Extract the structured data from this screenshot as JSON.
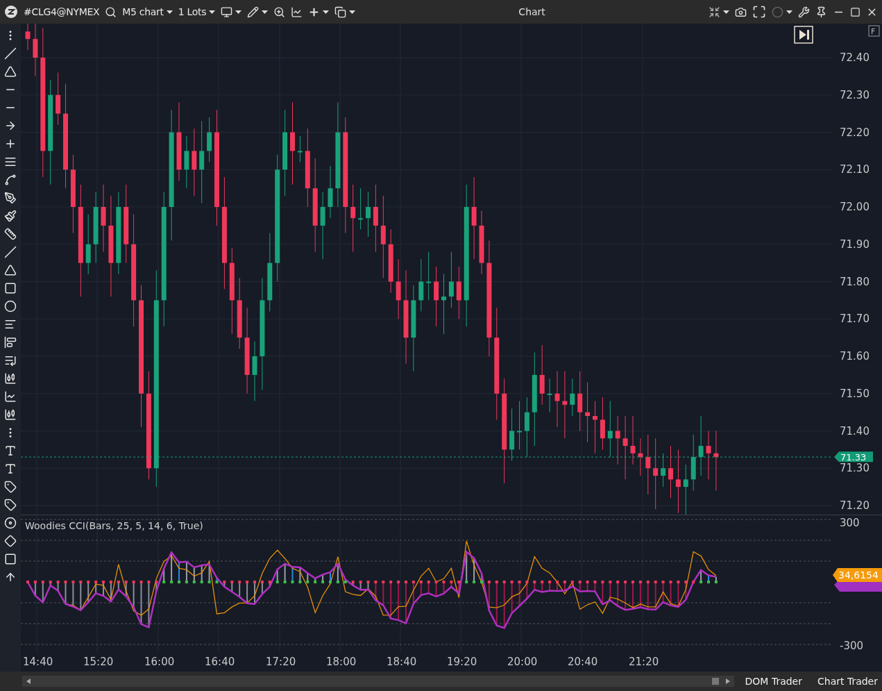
{
  "toolbar": {
    "symbol": "#CLG4@NYMEX",
    "chart_type": "M5 chart",
    "lots": "1 Lots"
  },
  "window": {
    "title": "Chart"
  },
  "corner_badge": "F",
  "price_axis": {
    "labels": [
      "72.40",
      "72.30",
      "72.20",
      "72.10",
      "72.00",
      "71.90",
      "71.80",
      "71.70",
      "71.60",
      "71.50",
      "71.40",
      "71.30",
      "71.20"
    ],
    "current_price": "71.33"
  },
  "indicator": {
    "title": "Woodies CCI(Bars, 25, 5, 14, 6, True)",
    "labels": [
      "300",
      "-300"
    ],
    "value": "34,6154"
  },
  "time_axis": {
    "labels": [
      "14:40",
      "15:20",
      "16:00",
      "16:40",
      "17:20",
      "18:00",
      "18:40",
      "19:20",
      "20:00",
      "20:40",
      "21:20"
    ]
  },
  "bottom_tabs": [
    "DOM Trader",
    "Chart Trader"
  ]
}
